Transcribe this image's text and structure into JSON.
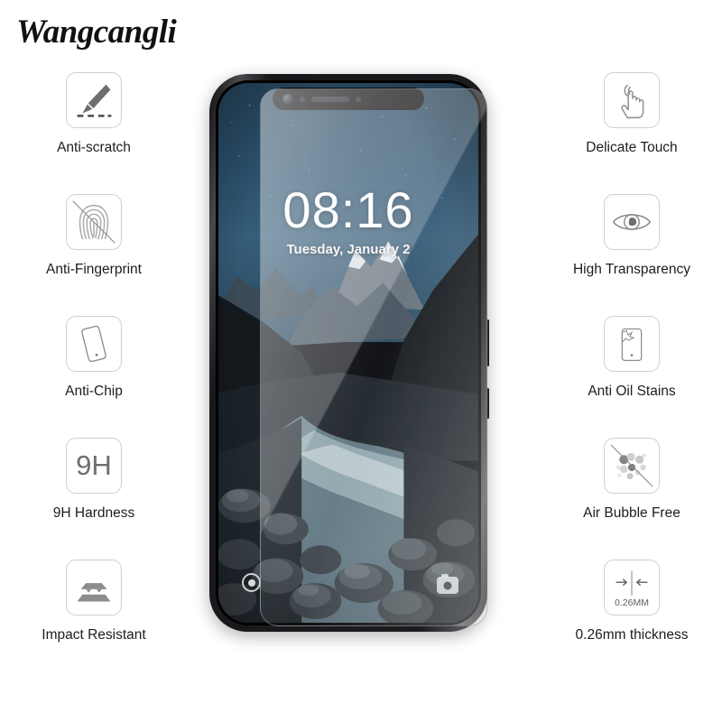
{
  "brand": {
    "name": "Wangcangli"
  },
  "features_left": [
    {
      "icon": "blade-scratch-icon",
      "label": "Anti-scratch"
    },
    {
      "icon": "fingerprint-blocked-icon",
      "label": "Anti-Fingerprint"
    },
    {
      "icon": "phone-chip-icon",
      "label": "Anti-Chip"
    },
    {
      "icon": "hardness-9h-icon",
      "label": "9H Hardness",
      "badge": "9H"
    },
    {
      "icon": "impact-plates-icon",
      "label": "Impact Resistant"
    }
  ],
  "features_right": [
    {
      "icon": "touch-hand-icon",
      "label": "Delicate Touch"
    },
    {
      "icon": "eye-icon",
      "label": "High Transparency"
    },
    {
      "icon": "phone-oil-stain-icon",
      "label": "Anti Oil Stains"
    },
    {
      "icon": "bubbles-blocked-icon",
      "label": "Air Bubble Free"
    },
    {
      "icon": "thickness-arrows-icon",
      "label": "0.26mm thickness",
      "badge": "0.26MM"
    }
  ],
  "phone": {
    "lockscreen": {
      "time": "08:16",
      "date": "Tuesday, January 2",
      "lock_shortcut": "lock-icon",
      "camera_shortcut": "camera-icon"
    },
    "hardware": {
      "front_camera": "front-camera-icon",
      "earpiece_speaker": "speaker-grille",
      "proximity_sensor": "sensor-dot",
      "power_button": "power-button",
      "volume_button": "volume-button"
    },
    "overlay": "tempered-glass-sheet"
  },
  "colors": {
    "icon_border": "#cfcfcf",
    "icon_art": "#6e6e6e",
    "label_text": "#1d1d1d",
    "brand_text": "#111111",
    "sky": "#2d5370",
    "background": "#ffffff"
  }
}
